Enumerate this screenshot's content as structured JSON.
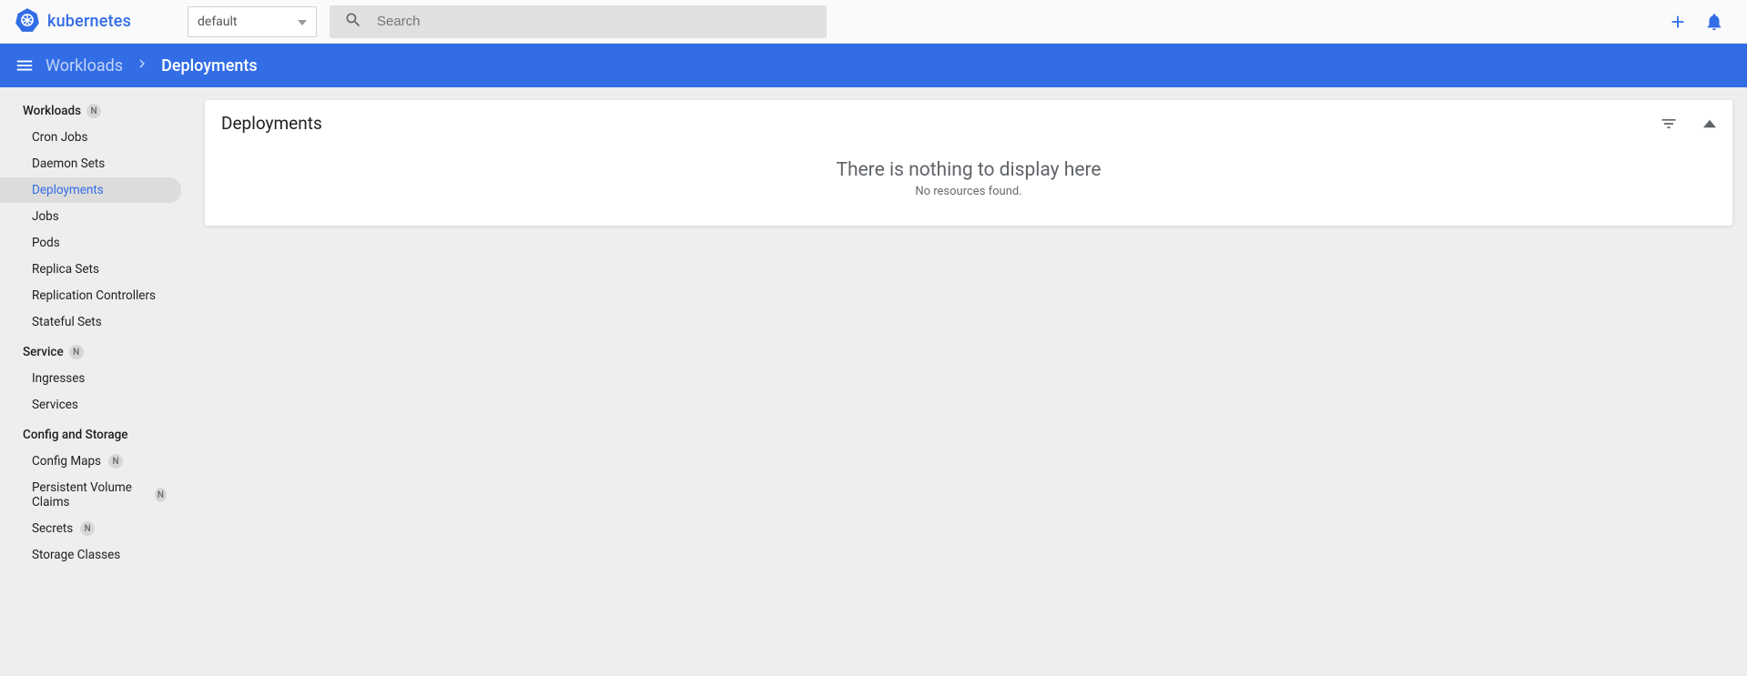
{
  "brand": {
    "name": "kubernetes"
  },
  "namespace": {
    "selected": "default"
  },
  "search": {
    "placeholder": "Search"
  },
  "breadcrumb": {
    "parent": "Workloads",
    "current": "Deployments"
  },
  "sidebar": {
    "sections": [
      {
        "title": "Workloads",
        "badge": "N",
        "items": [
          {
            "label": "Cron Jobs"
          },
          {
            "label": "Daemon Sets"
          },
          {
            "label": "Deployments",
            "active": true
          },
          {
            "label": "Jobs"
          },
          {
            "label": "Pods"
          },
          {
            "label": "Replica Sets"
          },
          {
            "label": "Replication Controllers"
          },
          {
            "label": "Stateful Sets"
          }
        ]
      },
      {
        "title": "Service",
        "badge": "N",
        "items": [
          {
            "label": "Ingresses"
          },
          {
            "label": "Services"
          }
        ]
      },
      {
        "title": "Config and Storage",
        "items": [
          {
            "label": "Config Maps",
            "badge": "N"
          },
          {
            "label": "Persistent Volume Claims",
            "badge": "N"
          },
          {
            "label": "Secrets",
            "badge": "N"
          },
          {
            "label": "Storage Classes"
          }
        ]
      }
    ]
  },
  "card": {
    "title": "Deployments",
    "empty_title": "There is nothing to display here",
    "empty_sub": "No resources found."
  }
}
